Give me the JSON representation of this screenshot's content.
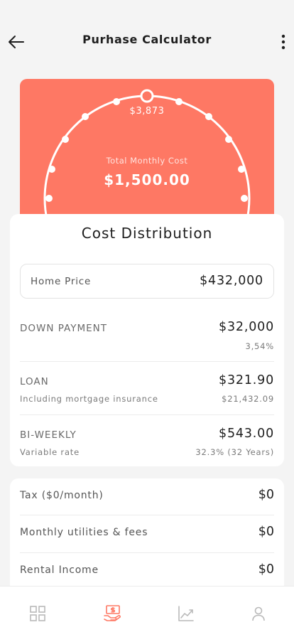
{
  "header": {
    "title": "Purhase Calculator",
    "back_icon": "arrow-left-icon",
    "more_icon": "more-vertical-icon"
  },
  "hero": {
    "top_value": "$3,873",
    "label": "Total Monthly Cost",
    "amount": "$1,500.00",
    "color": "#fe7864"
  },
  "distribution": {
    "title": "Cost Distribution",
    "home_price": {
      "label": "Home Price",
      "value": "$432,000"
    },
    "down_payment": {
      "label": "DOWN PAYMENT",
      "value": "$32,000",
      "subvalue": "3,54%"
    },
    "loan": {
      "label": "LOAN",
      "sub": "Including mortgage insurance",
      "value": "$321.90",
      "subvalue": "$21,432.09"
    },
    "bi_weekly": {
      "label": "BI-WEEKLY",
      "sub": "Variable rate",
      "value": "$543.00",
      "subvalue": "32.3% (32 Years)"
    }
  },
  "extras": [
    {
      "label": "Tax ($0/month)",
      "value": "$0"
    },
    {
      "label": "Monthly utilities & fees",
      "value": "$0"
    },
    {
      "label": "Rental Income",
      "value": "$0"
    }
  ],
  "nav": {
    "items": [
      "grid-icon",
      "money-hand-icon",
      "chart-line-icon",
      "user-icon"
    ],
    "active_color": "#fe7864",
    "inactive_color": "#b9b9b9"
  }
}
